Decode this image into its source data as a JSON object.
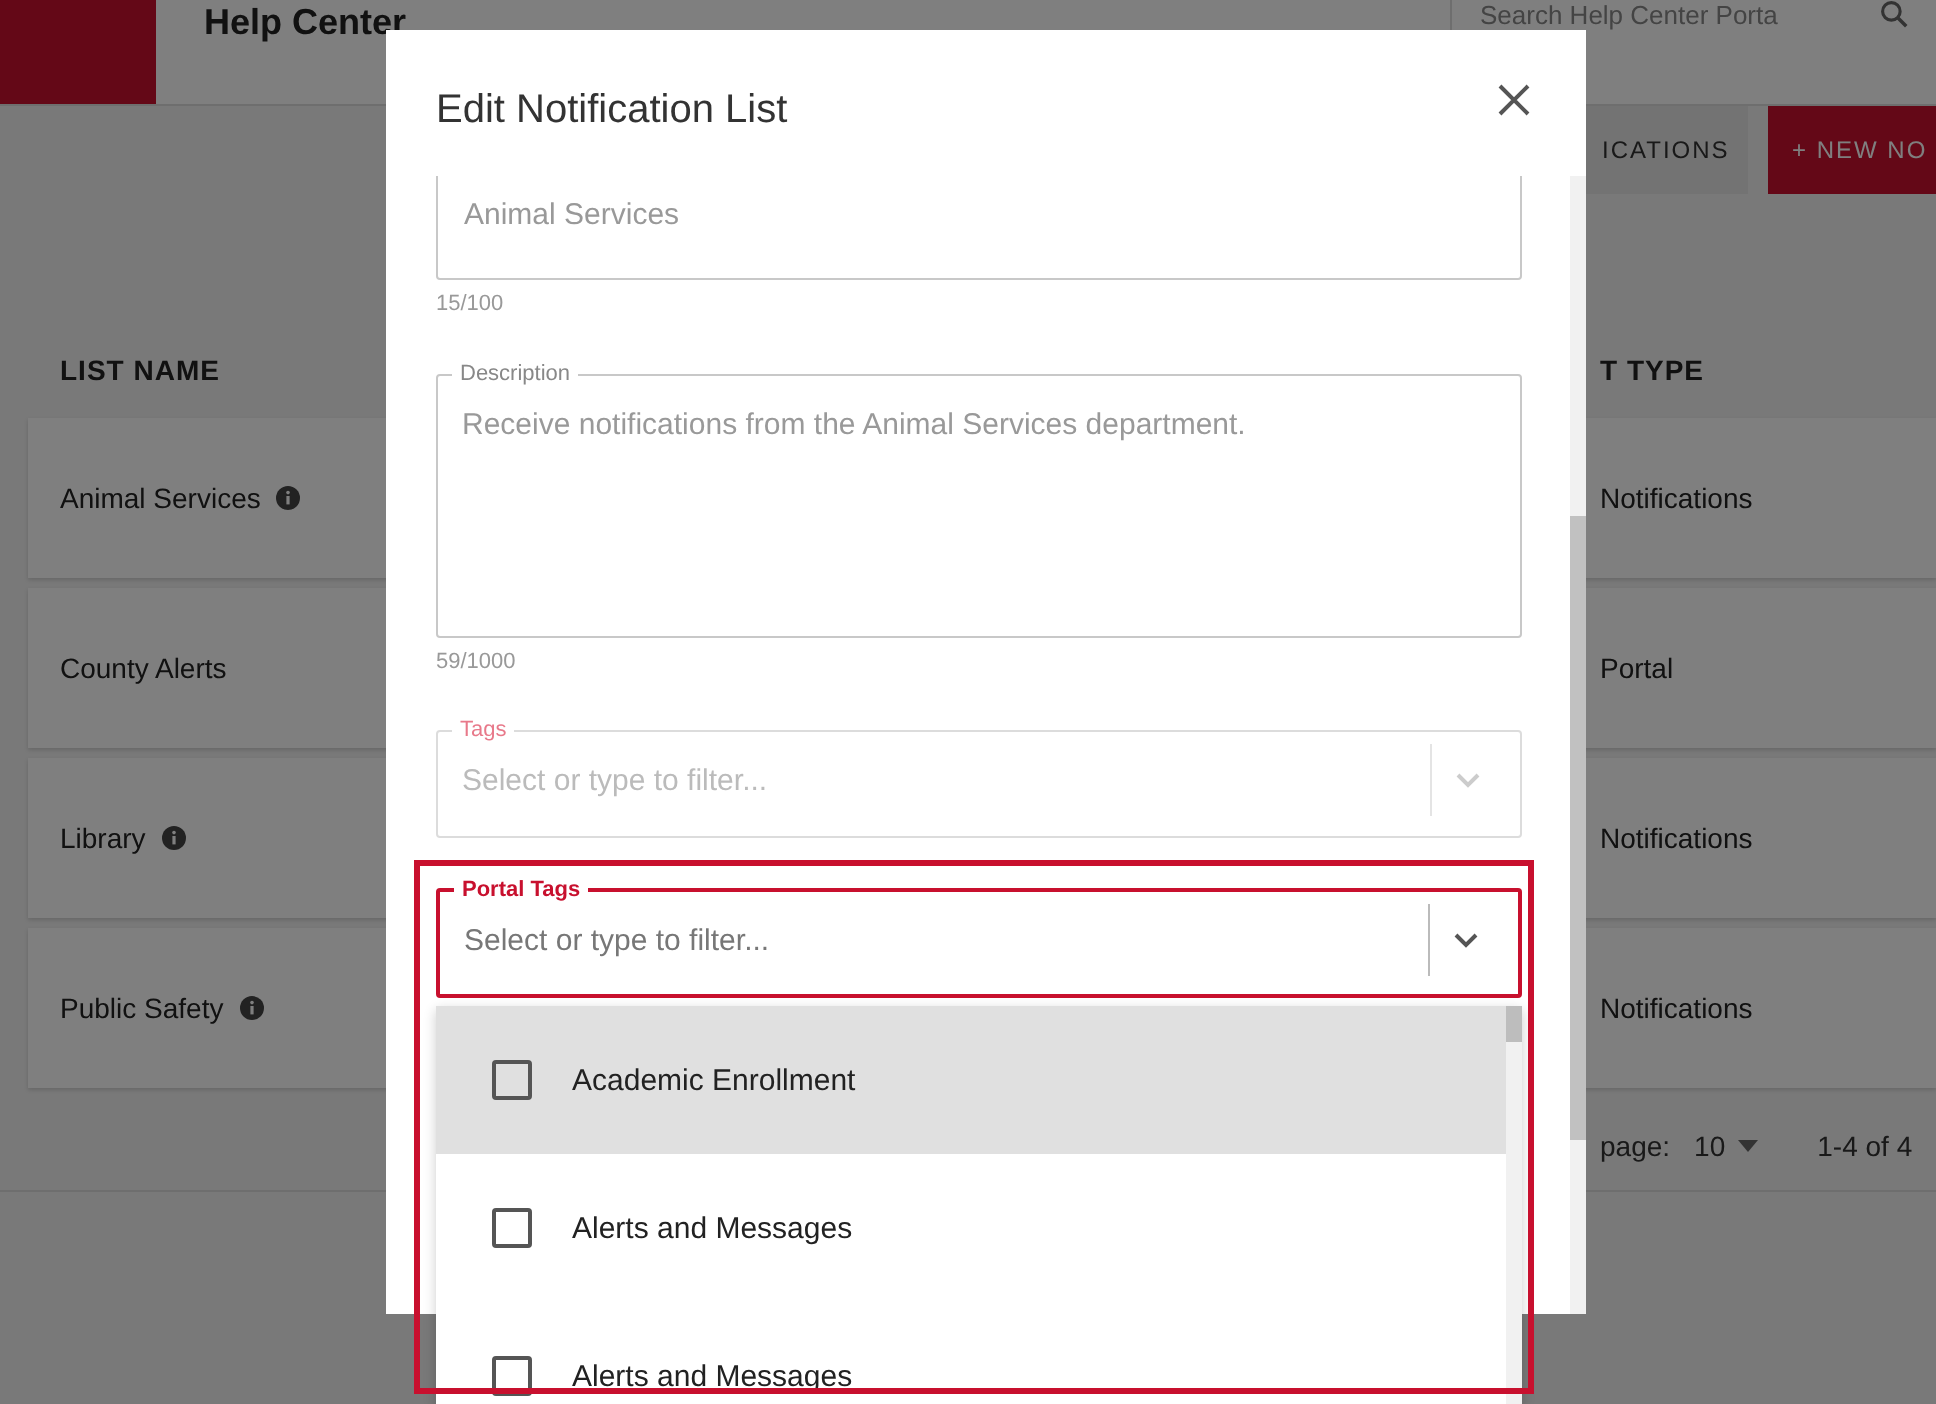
{
  "header": {
    "title": "Help Center",
    "search": {
      "placeholder": "Search Help Center Porta"
    }
  },
  "toolbar": {
    "buttons": [
      {
        "label": "ICATIONS",
        "kind": "secondary"
      },
      {
        "label": "+ NEW NO",
        "kind": "primary"
      }
    ]
  },
  "table": {
    "columns": [
      "LIST NAME",
      "T TYPE"
    ],
    "rows": [
      {
        "name": "Animal Services",
        "info": true,
        "type": "Notifications"
      },
      {
        "name": "County Alerts",
        "info": false,
        "type": "Portal"
      },
      {
        "name": "Library",
        "info": true,
        "type": "Notifications"
      },
      {
        "name": "Public Safety",
        "info": true,
        "type": "Notifications"
      }
    ]
  },
  "pagination": {
    "rows_per_page_label": "page:",
    "rows_per_page": "10",
    "range": "1-4 of 4"
  },
  "dialog": {
    "title": "Edit Notification List",
    "fields": [
      {
        "kind": "text",
        "value": "Animal Services",
        "counter": "15/100"
      },
      {
        "kind": "textarea",
        "label": "Description",
        "value": "Receive notifications from the Animal Services department.",
        "counter": "59/1000"
      },
      {
        "kind": "select",
        "label": "Tags",
        "placeholder": "Select or type to filter...",
        "focused": false,
        "highlighted": false
      },
      {
        "kind": "select",
        "label": "Portal Tags",
        "placeholder": "Select or type to filter...",
        "focused": true,
        "highlighted": true
      }
    ],
    "menu": {
      "options": [
        {
          "label": "Academic Enrollment",
          "checked": false,
          "highlighted": true
        },
        {
          "label": "Alerts and Messages",
          "checked": false,
          "highlighted": false
        },
        {
          "label": "Alerts and Messages",
          "checked": false,
          "highlighted": false
        }
      ]
    }
  }
}
